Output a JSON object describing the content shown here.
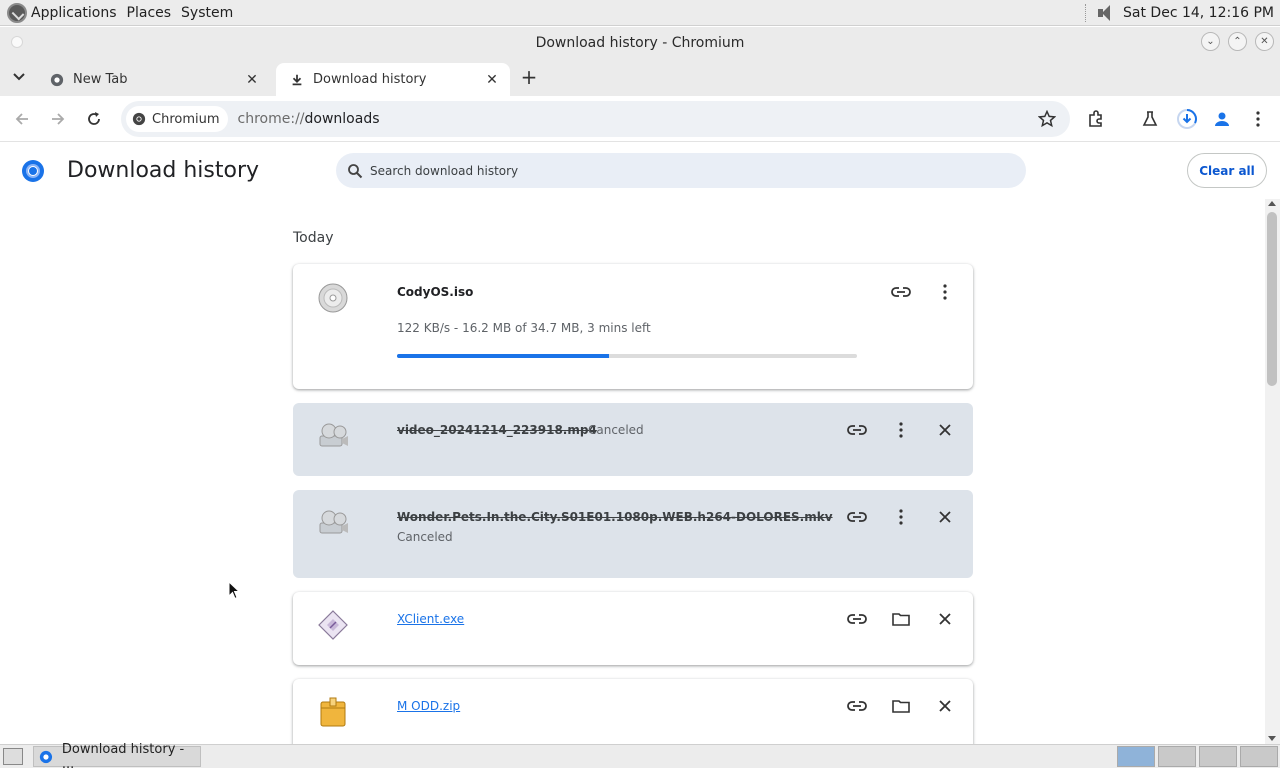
{
  "system_panel": {
    "menus": [
      "Applications",
      "Places",
      "System"
    ],
    "clock": "Sat Dec 14, 12:16 PM"
  },
  "window": {
    "title": "Download history - Chromium",
    "controls": [
      "⌄",
      "⌃",
      "✕"
    ]
  },
  "tabs": [
    {
      "label": "New Tab",
      "active": false
    },
    {
      "label": "Download history",
      "active": true
    }
  ],
  "toolbar": {
    "site_chip": "Chromium",
    "url_scheme": "chrome://",
    "url_host": "downloads"
  },
  "page": {
    "title": "Download history",
    "search_placeholder": "Search download history",
    "clear_all": "Clear all",
    "section": "Today"
  },
  "downloads": [
    {
      "name": "CodyOS.iso",
      "status": "122 KB/s - 16.2 MB of 34.7 MB, 3 mins left",
      "progress": 0.46,
      "icon": "disc-icon",
      "state": "in-progress"
    },
    {
      "name": "video_20241214_223918.mp4",
      "status": "Canceled",
      "icon": "film-reel-icon",
      "state": "canceled"
    },
    {
      "name": "Wonder.Pets.In.the.City.S01E01.1080p.WEB.h264-DOLORES.mkv",
      "status": "Canceled",
      "icon": "film-reel-icon",
      "state": "canceled"
    },
    {
      "name": "XClient.exe",
      "status": "",
      "icon": "executable-icon",
      "state": "complete"
    },
    {
      "name": "M ODD.zip",
      "status": "",
      "icon": "archive-icon",
      "state": "complete"
    }
  ],
  "taskbar": {
    "window_label": "Download history - ..."
  },
  "colors": {
    "accent": "#1a73e8",
    "canceled_card": "#dde3ea",
    "search_bg": "#e9eef6"
  }
}
